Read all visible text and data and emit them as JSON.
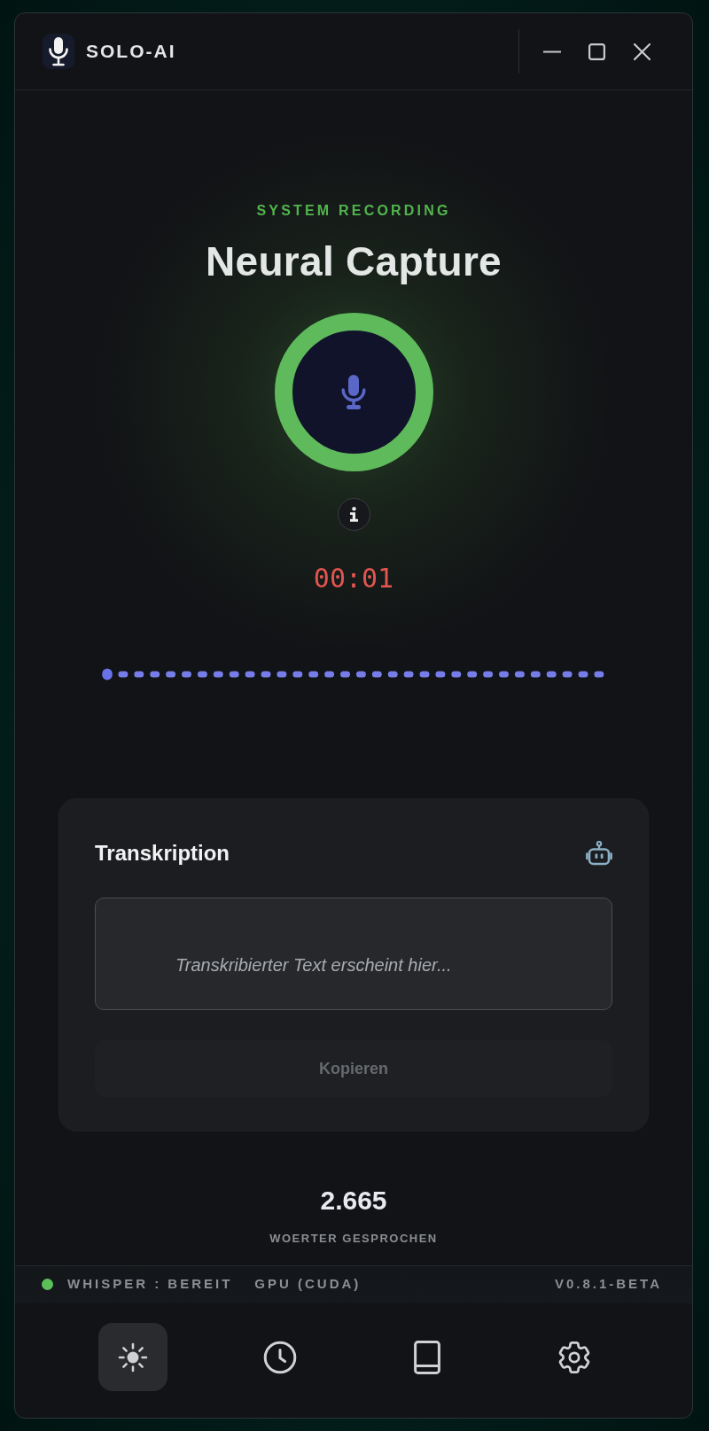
{
  "window": {
    "app_name": "SOLO-AI"
  },
  "recorder": {
    "eyebrow": "SYSTEM RECORDING",
    "title": "Neural Capture",
    "recording": true,
    "timer": "00:01"
  },
  "transcription": {
    "title": "Transkription",
    "placeholder": "Transkribierter Text erscheint hier...",
    "copy_button": {
      "label": "Kopieren",
      "disabled": true
    }
  },
  "stats": {
    "value": "2.665",
    "label": "WOERTER GESPROCHEN"
  },
  "status_bar": {
    "engine": {
      "text": "WHISPER : BEREIT",
      "ready": true
    },
    "device": "GPU (CUDA)",
    "version": "V0.8.1-BETA"
  },
  "nav": [
    {
      "selected": true
    },
    {
      "selected": false
    },
    {
      "selected": false
    },
    {
      "selected": false
    }
  ]
}
